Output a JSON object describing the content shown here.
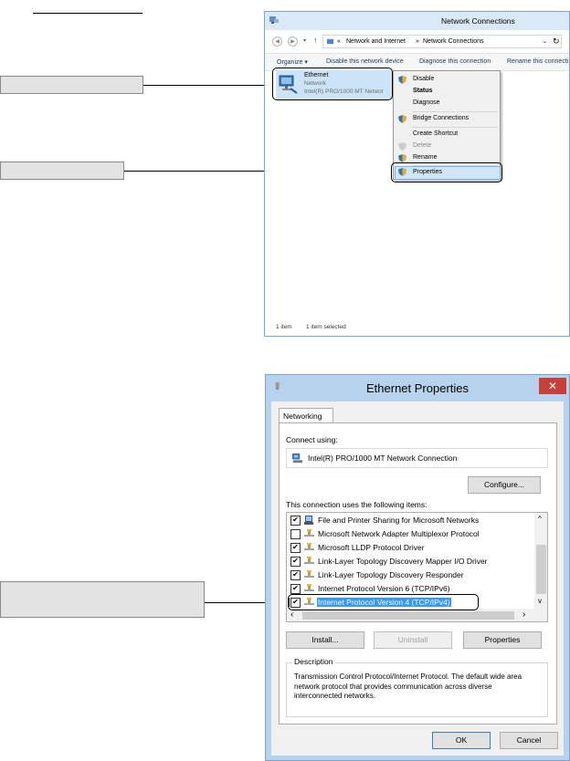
{
  "network_connections": {
    "title": "Network Connections",
    "breadcrumb": [
      "«",
      "Network and Internet",
      "»",
      "Network Connections"
    ],
    "toolbar": {
      "organize": "Organize ▾",
      "disable": "Disable this network device",
      "diagnose": "Diagnose this connection",
      "rename": "Rename this connecti"
    },
    "adapter": {
      "name": "Ethernet",
      "status": "Network",
      "device": "Intel(R) PRO/1000 MT Networ"
    },
    "context_menu": [
      "Disable",
      "Status",
      "Diagnose",
      "Bridge Connections",
      "Create Shortcut",
      "Delete",
      "Rename",
      "Properties"
    ],
    "statusbar": {
      "count": "1 item",
      "selected": "1 item selected"
    }
  },
  "ethernet_properties": {
    "title": "Ethernet Properties",
    "close": "✕",
    "tab": "Networking",
    "connect_using_label": "Connect using:",
    "adapter_name": "Intel(R) PRO/1000 MT Network Connection",
    "configure": "Configure...",
    "items_label": "This connection uses the following items:",
    "items": [
      {
        "label": "File and Printer Sharing for Microsoft Networks",
        "checked": true
      },
      {
        "label": "Microsoft Network Adapter Multiplexor Protocol",
        "checked": false
      },
      {
        "label": "Microsoft LLDP Protocol Driver",
        "checked": true
      },
      {
        "label": "Link-Layer Topology Discovery Mapper I/O Driver",
        "checked": true
      },
      {
        "label": "Link-Layer Topology Discovery Responder",
        "checked": true
      },
      {
        "label": "Internet Protocol Version 6 (TCP/IPv6)",
        "checked": true
      },
      {
        "label": "Internet Protocol Version 4 (TCP/IPv4)",
        "checked": true
      }
    ],
    "install": "Install...",
    "uninstall": "Uninstall",
    "properties": "Properties",
    "description_legend": "Description",
    "description": "Transmission Control Protocol/Internet Protocol. The default wide area network protocol that provides communication across diverse interconnected networks.",
    "ok": "OK",
    "cancel": "Cancel"
  },
  "check_mark": "✔",
  "icons": {
    "shield": "uac-shield-icon",
    "adapter": "network-adapter-icon",
    "network_component": "network-component-icon"
  },
  "colors": {
    "selection": "#3399ff",
    "menu_highlight": "#d1e5fa",
    "window_frame": "#b7d2ec",
    "close_button": "#c7403a"
  }
}
